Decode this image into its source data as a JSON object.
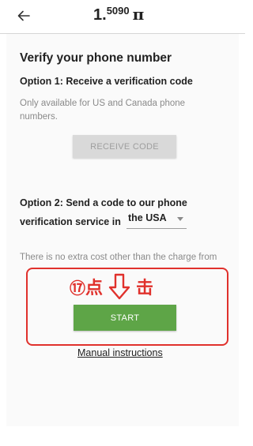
{
  "header": {
    "back_icon": "arrow-left-icon",
    "balance_int": "1.",
    "balance_frac": "5090",
    "currency_symbol": "π"
  },
  "verify": {
    "title": "Verify your phone number",
    "option1_title": "Option 1: Receive a verification code",
    "option1_note": "Only available for US and Canada phone numbers.",
    "receive_button": "RECEIVE CODE",
    "option2_line1": "Option 2: Send a code to our phone",
    "option2_line2": "verification service in",
    "country_selected": "the USA",
    "cost_note": "There is no extra cost other than the charge from",
    "start_button": "START",
    "manual_link": "Manual instructions"
  },
  "annotation": {
    "step_number": "⑰",
    "char1": "点",
    "char2": "击",
    "arrow_icon": "down-arrow-outline-icon",
    "color": "#e0312c"
  },
  "colors": {
    "start_button": "#5ea547",
    "receive_button_disabled": "#d9d9d9",
    "highlight_border": "#e0312c"
  }
}
